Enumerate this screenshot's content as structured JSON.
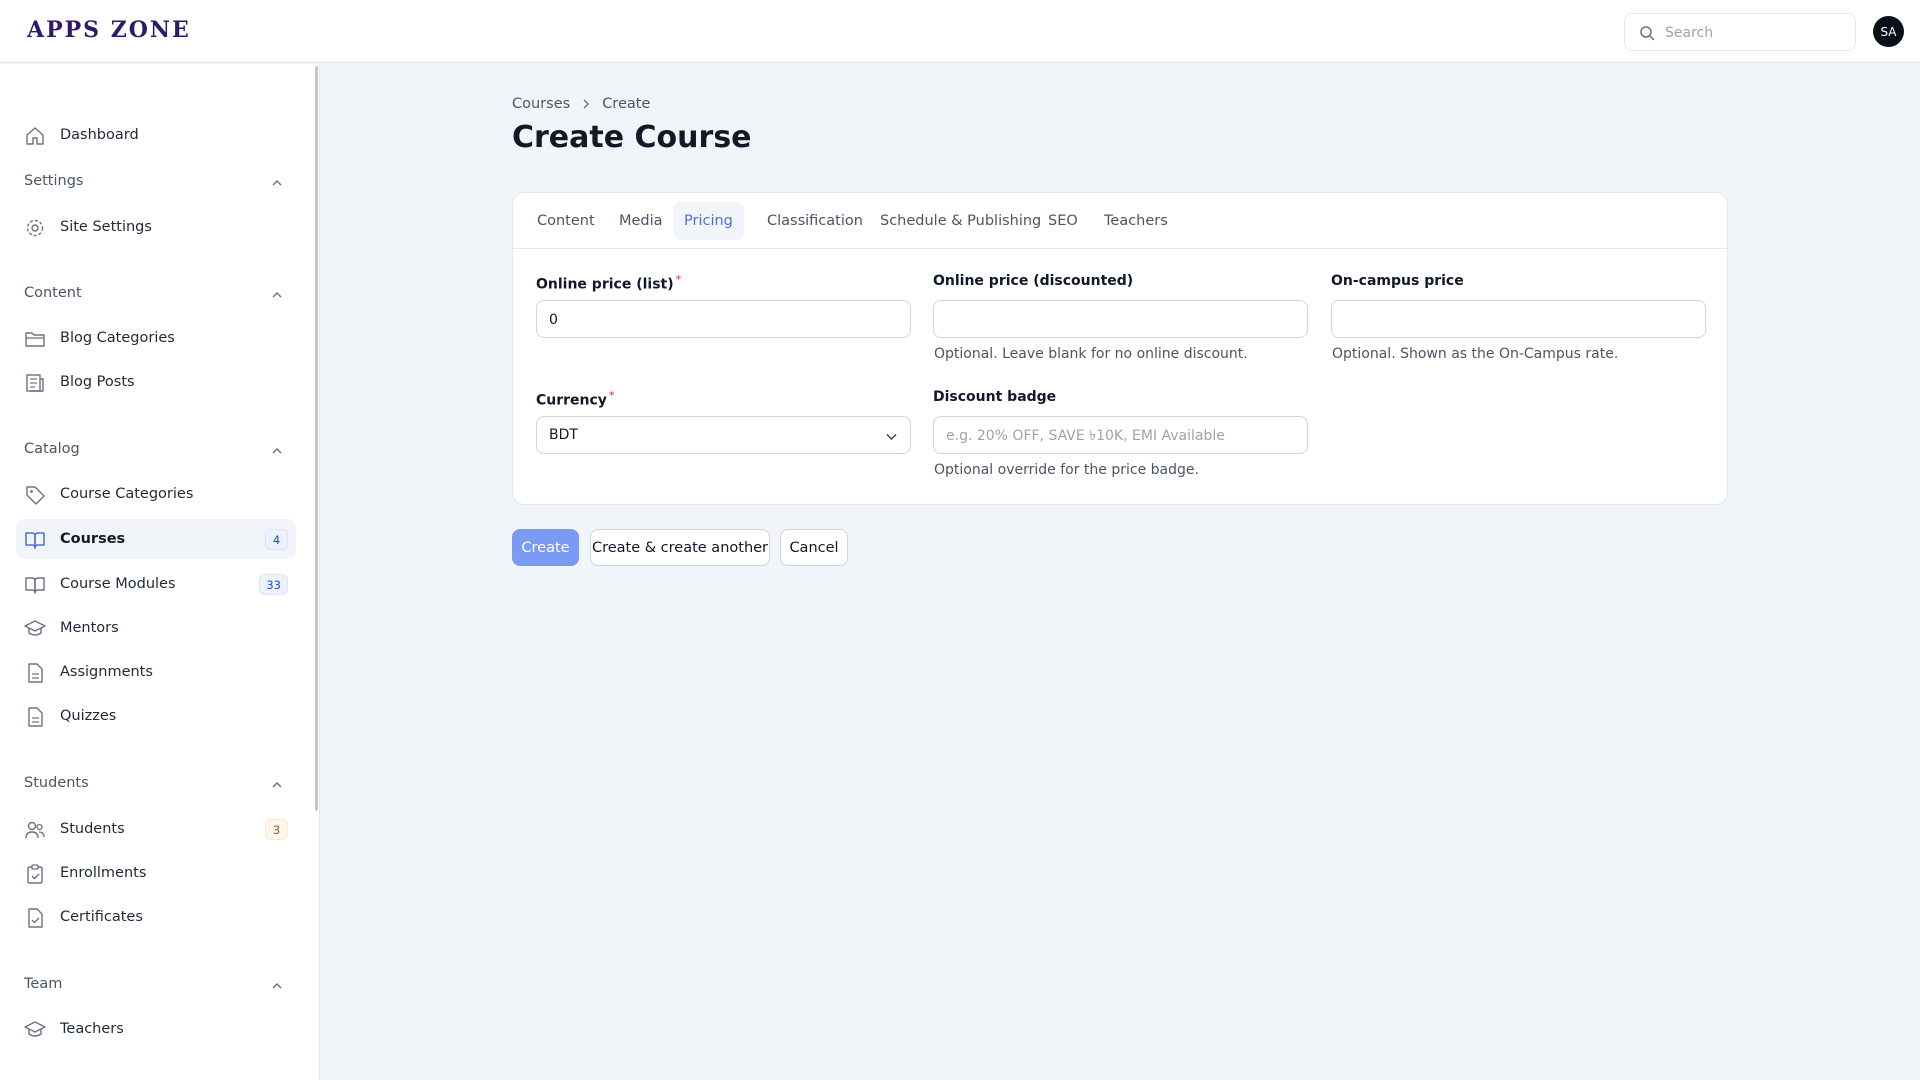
{
  "app": {
    "logo": "APPS ZONE"
  },
  "header": {
    "search_placeholder": "Search",
    "avatar_initials": "SA"
  },
  "sidebar": {
    "dashboard": "Dashboard",
    "groups": {
      "settings": "Settings",
      "content": "Content",
      "catalog": "Catalog",
      "students": "Students",
      "team": "Team"
    },
    "items": {
      "site_settings": "Site Settings",
      "blog_categories": "Blog Categories",
      "blog_posts": "Blog Posts",
      "course_categories": "Course Categories",
      "courses": "Courses",
      "courses_badge": "4",
      "course_modules": "Course Modules",
      "course_modules_badge": "33",
      "mentors": "Mentors",
      "assignments": "Assignments",
      "quizzes": "Quizzes",
      "students": "Students",
      "students_badge": "3",
      "enrollments": "Enrollments",
      "certificates": "Certificates",
      "teachers": "Teachers"
    }
  },
  "breadcrumb": {
    "parent": "Courses",
    "current": "Create"
  },
  "page": {
    "title": "Create Course"
  },
  "tabs": [
    "Content",
    "Media",
    "Pricing",
    "Classification",
    "Schedule & Publishing",
    "SEO",
    "Teachers"
  ],
  "active_tab": "Pricing",
  "form": {
    "online_price_list": {
      "label": "Online price (list)",
      "required_mark": "*",
      "value": "0"
    },
    "online_price_discounted": {
      "label": "Online price (discounted)",
      "value": "",
      "hint": "Optional. Leave blank for no online discount."
    },
    "on_campus_price": {
      "label": "On-campus price",
      "value": "",
      "hint": "Optional. Shown as the On-Campus rate."
    },
    "currency": {
      "label": "Currency",
      "required_mark": "*",
      "value": "BDT"
    },
    "discount_badge": {
      "label": "Discount badge",
      "placeholder": "e.g. 20% OFF, SAVE ৳10K, EMI Available",
      "value": "",
      "hint": "Optional override for the price badge."
    }
  },
  "actions": {
    "create": "Create",
    "create_another": "Create & create another",
    "cancel": "Cancel"
  },
  "colors": {
    "accent": "#4f6fd8",
    "primary_button": "#7b9af3",
    "background": "#f1f4f9",
    "required": "#dc2626"
  }
}
